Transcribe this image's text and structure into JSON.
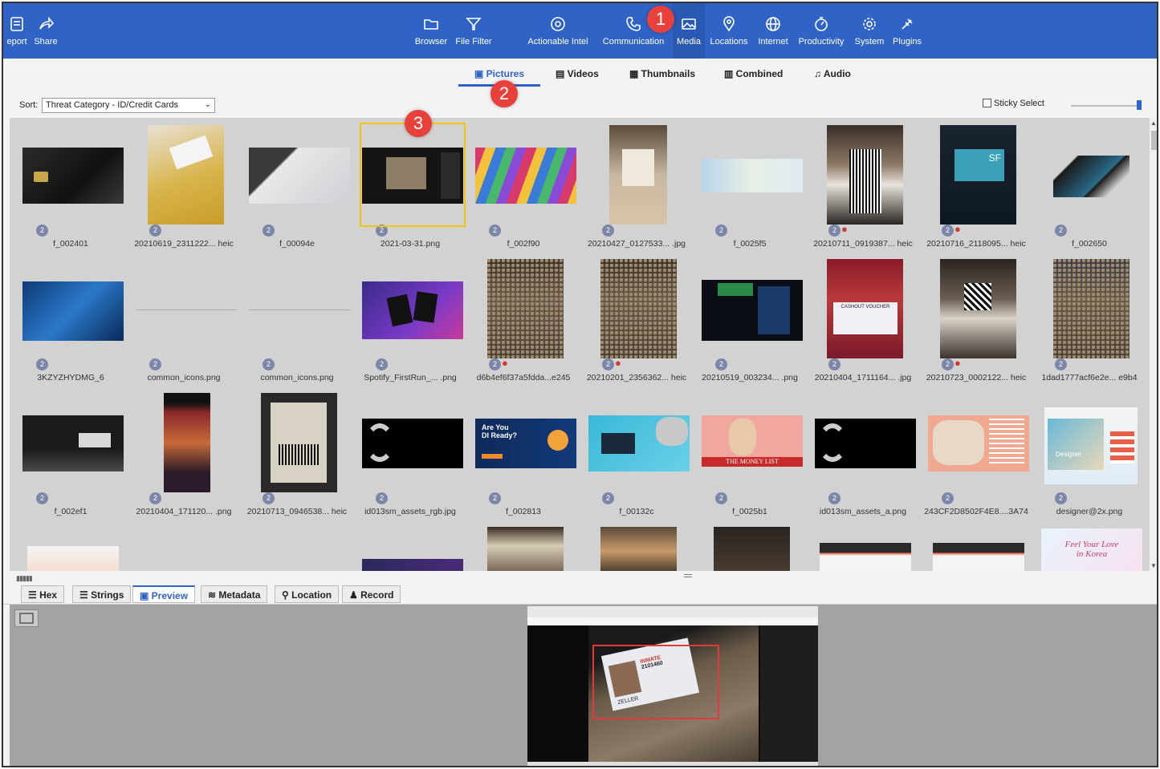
{
  "toolbar": {
    "items": [
      {
        "label": "eport",
        "icon": "report-icon"
      },
      {
        "label": "Share",
        "icon": "share-icon"
      },
      {
        "label": "Browser",
        "icon": "folder-icon"
      },
      {
        "label": "File Filter",
        "icon": "filter-icon"
      },
      {
        "label": "Actionable Intel",
        "icon": "intel-icon"
      },
      {
        "label": "Communication",
        "icon": "phone-icon"
      },
      {
        "label": "Media",
        "icon": "image-icon"
      },
      {
        "label": "Locations",
        "icon": "location-pin-icon"
      },
      {
        "label": "Internet",
        "icon": "globe-icon"
      },
      {
        "label": "Productivity",
        "icon": "timer-icon"
      },
      {
        "label": "System",
        "icon": "gear-icon"
      },
      {
        "label": "Plugins",
        "icon": "plug-icon"
      }
    ],
    "active": "Media"
  },
  "callouts": [
    "1",
    "2",
    "3"
  ],
  "subtabs": [
    {
      "label": "Pictures",
      "icon": "picture-icon"
    },
    {
      "label": "Videos",
      "icon": "film-icon"
    },
    {
      "label": "Thumbnails",
      "icon": "thumbnails-icon"
    },
    {
      "label": "Combined",
      "icon": "combined-icon"
    },
    {
      "label": "Audio",
      "icon": "music-note-icon"
    }
  ],
  "sort": {
    "label": "Sort:",
    "value": "Threat Category - ID/Credit Cards"
  },
  "sticky_select": "Sticky Select",
  "grid": {
    "badge": "2",
    "rows": [
      [
        "f_002401",
        "20210619_2311222... heic",
        "f_00094e",
        "2021-03-31.png",
        "f_002f90",
        "20210427_0127533... .jpg",
        "f_0025f5",
        "20210711_0919387... heic",
        "20210716_2118095... heic",
        "f_002650"
      ],
      [
        "3KZYZHYDMG_6",
        "common_icons.png",
        "common_icons.png",
        "Spotify_FirstRun_... .png",
        "d6b4ef6f37a5fdda...e245",
        "20210201_2356362... heic",
        "20210519_003234... .png",
        "20210404_1711164... .jpg",
        "20210723_0002122... heic",
        "1dad1777acf6e2e... e9b4"
      ],
      [
        "f_002ef1",
        "20210404_171120... .png",
        "20210713_0946538... heic",
        "id013sm_assets_rgb.jpg",
        "f_002813",
        "f_00132c",
        "f_0025b1",
        "id013sm_assets_a.png",
        "243CF2D8502F4E8....3A74",
        "designer@2x.png"
      ]
    ]
  },
  "bottom_tabs": [
    {
      "label": "Hex",
      "icon": "hex-icon"
    },
    {
      "label": "Strings",
      "icon": "strings-icon"
    },
    {
      "label": "Preview",
      "icon": "preview-icon"
    },
    {
      "label": "Metadata",
      "icon": "metadata-icon"
    },
    {
      "label": "Location",
      "icon": "location-pin-icon"
    },
    {
      "label": "Record",
      "icon": "record-icon"
    }
  ],
  "active_bottom_tab": "Preview",
  "thumb_text": {
    "are_you": "Are You",
    "di_ready": "DI Ready?",
    "money_list": "THE MONEY LIST",
    "feel_love": "Feel Your Love",
    "in_korea": "in Korea",
    "sf": "SF",
    "designer": "Designer",
    "cashout": "CASHOUT VOUCHER"
  },
  "preview_card": {
    "inmate": "INMATE",
    "number": "2101460",
    "name": "ZELLER"
  }
}
